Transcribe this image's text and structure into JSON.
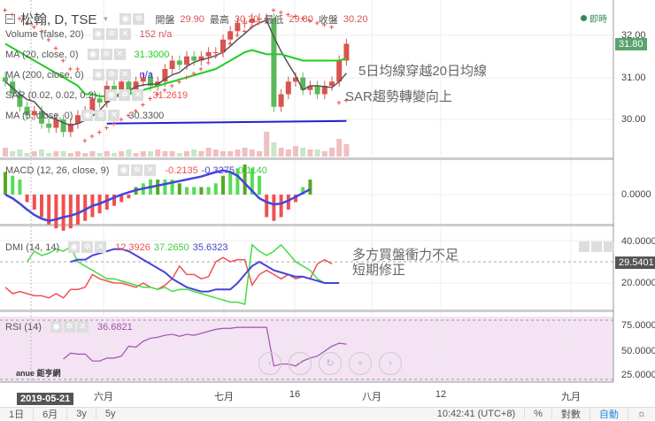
{
  "header": {
    "symbol": "松翰, D, TSE",
    "open_label": "開盤",
    "open": "29.90",
    "high_label": "最高",
    "high": "30.20",
    "low_label": "最低",
    "low": "29.80",
    "close_label": "收盤",
    "close": "30.20",
    "live": "即時"
  },
  "legends": [
    {
      "label": "Volume (false, 20)",
      "value": "152 n/a",
      "color": "#d9534f"
    },
    {
      "label": "MA (20, close, 0)",
      "value": "31.3000",
      "color": "#22cc22"
    },
    {
      "label": "MA (200, close, 0)",
      "value": "n/a",
      "color": "#2222cc"
    },
    {
      "label": "SAR (0.02, 0.02, 0.2)",
      "value": "31.2619",
      "color": "#f05050"
    },
    {
      "label": "MA (5, close, 0)",
      "value": "30.3300",
      "color": "#555555"
    }
  ],
  "macd": {
    "label": "MACD (12, 26, close, 9)",
    "v1": "-0.2135",
    "v2": "-0.3275",
    "v3": "0.1140",
    "axis": "0.0000"
  },
  "dmi": {
    "label": "DMI (14, 14)",
    "v1": "12.3926",
    "v2": "37.2650",
    "v3": "35.6323",
    "axis_top": "40.0000",
    "axis_cur": "29.5401",
    "axis_low": "20.0000"
  },
  "rsi": {
    "label": "RSI (14)",
    "v1": "36.6821",
    "axis_top": "75.0000",
    "axis_mid": "50.0000",
    "axis_low": "25.0000"
  },
  "price_axis": {
    "p32": "32.00",
    "cur": "31.80",
    "p31": "31.00",
    "p30": "30.00"
  },
  "annotations": {
    "a1": "5日均線穿越20日均線",
    "a2": "SAR趨勢轉變向上",
    "a3": "多方買盤衝力不足",
    "a4": "短期修正"
  },
  "time_axis": {
    "cursor": "2019-05-21",
    "ticks": [
      "六月",
      "七月",
      "16",
      "八月",
      "12",
      "九月"
    ]
  },
  "bottom_bar": {
    "ranges": [
      "1日",
      "6月",
      "3y",
      "5y"
    ],
    "time": "10:42:41 (UTC+8)",
    "percent": "%",
    "log": "對數",
    "auto": "自動"
  },
  "logo": "anue 鉅亨網",
  "colors": {
    "up": "#d9534f",
    "down": "#5cb85c",
    "ma5": "#555555",
    "ma20": "#22cc22",
    "ma200": "#2222cc",
    "sar": "#f05050"
  },
  "chart_data": {
    "type": "candlestick",
    "close": [
      30.9,
      30.6,
      30.3,
      30.1,
      30.2,
      29.9,
      29.8,
      30.0,
      29.7,
      29.9,
      30.1,
      30.2,
      30.5,
      30.4,
      30.8,
      30.7,
      30.9,
      30.6,
      30.9,
      31.0,
      30.8,
      30.9,
      31.2,
      31.4,
      31.3,
      31.5,
      31.4,
      31.5,
      31.6,
      31.6,
      31.9,
      32.1,
      32.3,
      32.3,
      32.4,
      32.4,
      32.4,
      30.3,
      30.6,
      30.9,
      31.0,
      30.7,
      30.8,
      30.6,
      30.8,
      30.9,
      31.4,
      31.8
    ],
    "ma20": [
      31.8,
      31.7,
      31.6,
      31.5,
      31.4,
      31.3,
      31.2,
      31.1,
      31.0,
      30.9,
      30.8,
      30.6,
      30.6,
      30.55,
      30.55,
      30.55,
      30.55,
      30.6,
      30.65,
      30.7,
      30.75,
      30.8,
      30.85,
      30.9,
      30.95,
      31.0,
      31.05,
      31.1,
      31.15,
      31.2,
      31.3,
      31.4,
      31.5,
      31.6,
      31.65,
      31.6,
      31.55,
      31.55,
      31.55,
      31.5,
      31.45,
      31.4,
      31.4,
      31.4,
      31.4,
      31.4,
      31.4,
      31.45
    ],
    "ma200_start": 14,
    "ma200": 29.9,
    "sar": [
      32.6,
      32.5,
      32.4,
      32.3,
      32.2,
      32.1,
      31.9,
      31.7,
      31.4,
      31.2,
      31.2,
      29.5,
      29.6,
      29.7,
      29.8,
      29.9,
      30.0,
      30.1,
      30.2,
      30.35,
      30.5,
      30.6,
      30.7,
      30.8,
      30.9,
      31.0,
      31.1,
      31.2,
      31.35,
      31.5,
      31.6,
      31.8,
      32.0,
      32.1,
      32.2,
      32.3,
      32.4,
      32.6,
      32.55,
      32.5,
      32.45,
      32.4,
      32.35,
      32.3,
      32.25,
      32.2,
      30.4,
      30.45
    ],
    "volume": [
      5,
      3,
      4,
      2,
      3,
      4,
      2,
      3,
      3,
      2,
      3,
      2,
      3,
      2,
      3,
      2,
      3,
      4,
      2,
      3,
      3,
      4,
      3,
      3,
      2,
      3,
      4,
      3,
      5,
      4,
      3,
      3,
      4,
      5,
      4,
      3,
      14,
      8,
      5,
      4,
      6,
      5,
      4,
      4,
      3,
      5,
      10,
      7
    ],
    "macd_line": [
      0,
      -0.05,
      -0.12,
      -0.2,
      -0.27,
      -0.32,
      -0.35,
      -0.33,
      -0.3,
      -0.28,
      -0.25,
      -0.2,
      -0.15,
      -0.12,
      -0.08,
      -0.04,
      0,
      0.03,
      0.06,
      0.08,
      0.1,
      0.12,
      0.14,
      0.16,
      0.18,
      0.2,
      0.22,
      0.24,
      0.27,
      0.3,
      0.32,
      0.3,
      0.25,
      0.15,
      0.05,
      -0.05,
      -0.1,
      -0.13,
      -0.12,
      -0.08,
      -0.03,
      0.02,
      0.07
    ],
    "macd_hist": [
      0.3,
      0.25,
      0.2,
      -0.1,
      -0.2,
      -0.3,
      -0.4,
      -0.45,
      -0.48,
      -0.45,
      -0.4,
      -0.35,
      -0.3,
      -0.25,
      -0.2,
      -0.15,
      -0.1,
      -0.05,
      0.1,
      0.15,
      0.2,
      0.2,
      0.2,
      0.2,
      0.15,
      0.1,
      0.1,
      0.1,
      0.1,
      0.15,
      0.25,
      0.3,
      0.35,
      0.4,
      0.35,
      0.25,
      -0.3,
      -0.35,
      -0.3,
      -0.2,
      -0.1,
      0.1,
      0.2
    ],
    "dmi_plus": [
      18,
      15,
      16,
      15,
      14,
      14,
      13,
      15,
      13,
      17,
      17,
      18,
      24,
      22,
      21,
      20,
      20,
      19,
      18,
      20,
      18,
      17,
      19,
      22,
      28,
      24,
      24,
      22,
      23,
      30,
      32,
      30,
      31,
      31,
      19,
      24,
      26,
      24,
      22,
      24,
      22,
      23,
      22,
      29,
      31,
      29
    ],
    "dmi_minus": [
      30,
      35,
      33,
      34,
      36,
      35,
      37,
      30,
      28,
      26,
      24,
      22,
      22,
      21,
      20,
      19,
      18,
      18,
      17,
      18,
      16,
      17,
      17,
      16,
      15,
      14,
      13,
      12,
      11,
      11,
      10,
      38,
      35,
      33,
      35,
      38,
      34,
      30,
      28,
      26,
      22,
      20,
      20
    ],
    "adx": [
      30,
      31,
      31,
      33,
      34,
      35,
      36,
      36,
      35,
      33,
      31,
      29,
      27,
      25,
      22,
      20,
      18,
      17,
      16,
      16,
      17,
      17,
      17,
      20,
      24,
      28,
      30,
      28,
      26,
      25,
      24,
      23,
      23,
      22,
      21,
      20,
      20,
      20
    ],
    "rsi": [
      42,
      48,
      47,
      47,
      40,
      40,
      43,
      43,
      45,
      55,
      54,
      60,
      63,
      64,
      66,
      67,
      65,
      67,
      66,
      68,
      70,
      72,
      73,
      73,
      74,
      74,
      74,
      74,
      74,
      35,
      37,
      37,
      35,
      40,
      43,
      45,
      50,
      55,
      58,
      57
    ]
  }
}
